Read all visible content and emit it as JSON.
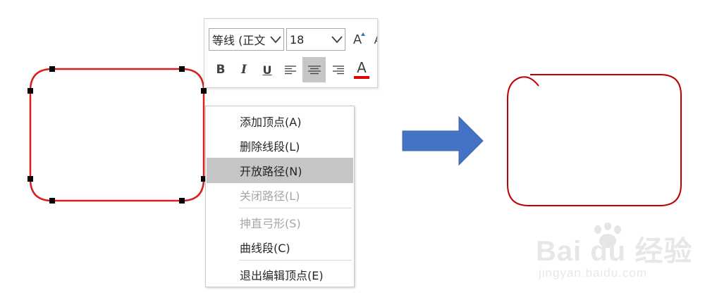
{
  "toolbar": {
    "font_name": "等线 (正文",
    "font_size": "18",
    "grow_font_glyph": "A",
    "shrink_font_glyph": "A",
    "bold_glyph": "B",
    "italic_glyph": "I",
    "underline_glyph": "U",
    "font_color_glyph": "A",
    "font_color": "#e00000",
    "selected_alignment": "center"
  },
  "context_menu": {
    "items": [
      {
        "label": "添加顶点(A)",
        "enabled": true,
        "highlighted": false
      },
      {
        "label": "删除线段(L)",
        "enabled": true,
        "highlighted": false
      },
      {
        "label": "开放路径(N)",
        "enabled": true,
        "highlighted": true
      },
      {
        "label": "关闭路径(L)",
        "enabled": false,
        "highlighted": false
      },
      {
        "label": "抻直弓形(S)",
        "enabled": false,
        "highlighted": false
      },
      {
        "label": "曲线段(C)",
        "enabled": true,
        "highlighted": false
      },
      {
        "label": "退出编辑顶点(E)",
        "enabled": true,
        "highlighted": false
      }
    ]
  },
  "colors": {
    "shape_outline": "#d81e1e",
    "result_outline": "#c00000",
    "arrow_fill": "#4472c4",
    "highlight": "#c6c6c6"
  },
  "icons": [
    "chevron-down-icon",
    "grow-font-icon",
    "shrink-font-icon",
    "align-left-icon",
    "align-center-icon",
    "align-right-icon",
    "font-color-icon",
    "right-arrow-icon"
  ],
  "watermark": {
    "logo": "Bai du 经验",
    "url": "jingyan.baidu.com"
  }
}
